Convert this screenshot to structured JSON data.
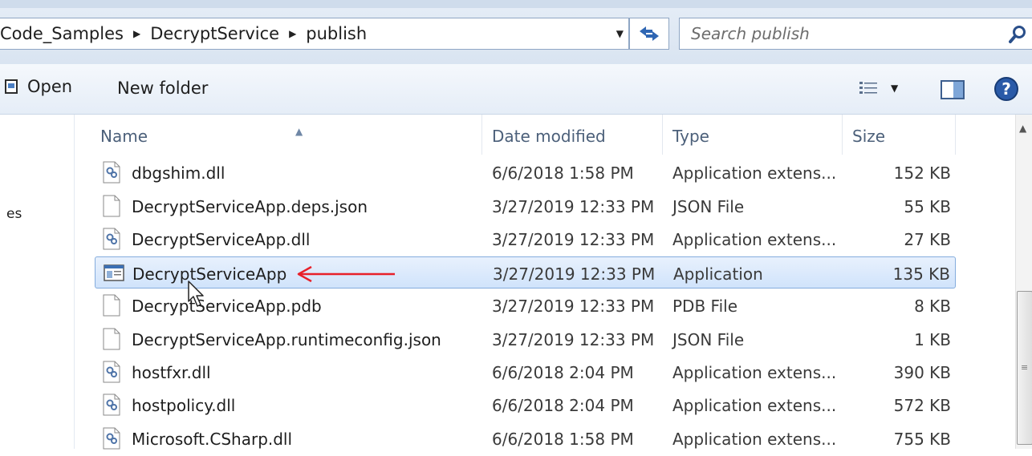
{
  "address": {
    "breadcrumbs": [
      "Code_Samples",
      "DecryptService",
      "publish"
    ],
    "dropdown_icon": "chevron-down-icon",
    "refresh_icon": "refresh-icon"
  },
  "search": {
    "placeholder": "Search publish",
    "icon": "search-icon"
  },
  "toolbar": {
    "open_label": "Open",
    "new_folder_label": "New folder",
    "views_icon": "views-icon",
    "preview_icon": "preview-pane-icon",
    "help_icon": "help-icon"
  },
  "nav": {
    "partial_label": "es"
  },
  "columns": {
    "name": "Name",
    "date": "Date modified",
    "type": "Type",
    "size": "Size"
  },
  "files": [
    {
      "name": "dbgshim.dll",
      "date": "6/6/2018 1:58 PM",
      "type": "Application extens...",
      "size": "152 KB",
      "icon": "dll-icon"
    },
    {
      "name": "DecryptServiceApp.deps.json",
      "date": "3/27/2019 12:33 PM",
      "type": "JSON File",
      "size": "55 KB",
      "icon": "file-icon"
    },
    {
      "name": "DecryptServiceApp.dll",
      "date": "3/27/2019 12:33 PM",
      "type": "Application extens...",
      "size": "27 KB",
      "icon": "dll-icon"
    },
    {
      "name": "DecryptServiceApp",
      "date": "3/27/2019 12:33 PM",
      "type": "Application",
      "size": "135 KB",
      "icon": "application-icon"
    },
    {
      "name": "DecryptServiceApp.pdb",
      "date": "3/27/2019 12:33 PM",
      "type": "PDB File",
      "size": "8 KB",
      "icon": "file-icon"
    },
    {
      "name": "DecryptServiceApp.runtimeconfig.json",
      "date": "3/27/2019 12:33 PM",
      "type": "JSON File",
      "size": "1 KB",
      "icon": "file-icon"
    },
    {
      "name": "hostfxr.dll",
      "date": "6/6/2018 2:04 PM",
      "type": "Application extens...",
      "size": "390 KB",
      "icon": "dll-icon"
    },
    {
      "name": "hostpolicy.dll",
      "date": "6/6/2018 2:04 PM",
      "type": "Application extens...",
      "size": "572 KB",
      "icon": "dll-icon"
    },
    {
      "name": "Microsoft.CSharp.dll",
      "date": "6/6/2018 1:58 PM",
      "type": "Application extens...",
      "size": "755 KB",
      "icon": "dll-icon"
    }
  ],
  "colors": {
    "annotation_arrow": "#e8202a",
    "selection_border": "#84acdd",
    "header_text": "#4c607a"
  }
}
